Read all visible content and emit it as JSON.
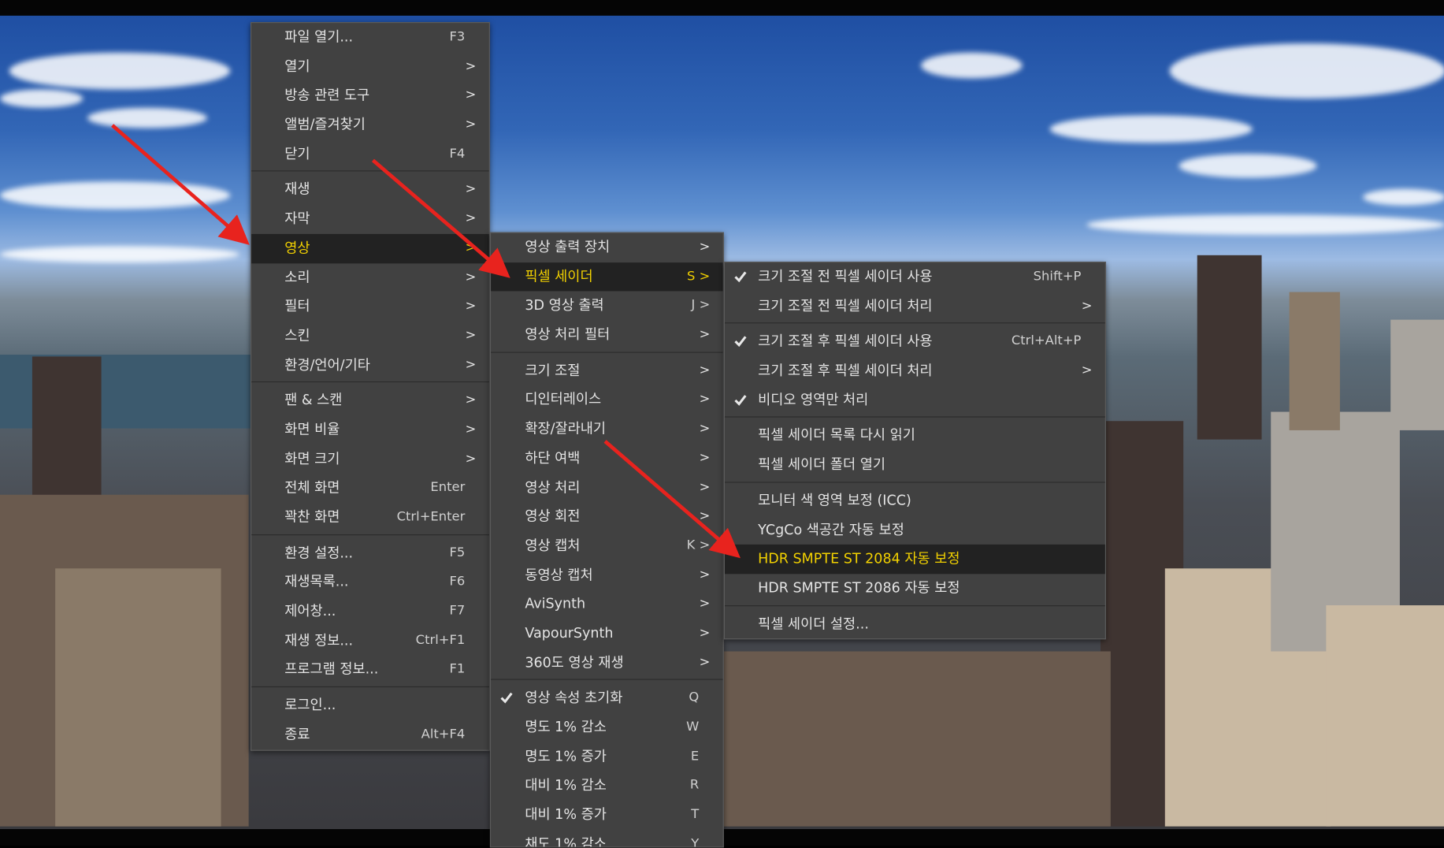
{
  "colors": {
    "menu_bg": "#414141",
    "highlight_bg": "#222222",
    "highlight_text": "#f2d100",
    "text": "#e4e4e4",
    "annotation_arrow": "#e8231e"
  },
  "main_menu": [
    {
      "label": "파일 열기...",
      "shortcut": "F3"
    },
    {
      "label": "열기",
      "shortcut": ">"
    },
    {
      "label": "방송 관련 도구",
      "shortcut": ">"
    },
    {
      "label": "앨범/즐겨찾기",
      "shortcut": ">"
    },
    {
      "label": "닫기",
      "shortcut": "F4"
    },
    {
      "separator": true
    },
    {
      "label": "재생",
      "shortcut": ">"
    },
    {
      "label": "자막",
      "shortcut": ">"
    },
    {
      "label": "영상",
      "shortcut": ">",
      "active": true
    },
    {
      "label": "소리",
      "shortcut": ">"
    },
    {
      "label": "필터",
      "shortcut": ">"
    },
    {
      "label": "스킨",
      "shortcut": ">"
    },
    {
      "label": "환경/언어/기타",
      "shortcut": ">"
    },
    {
      "separator": true
    },
    {
      "label": "팬 & 스캔",
      "shortcut": ">"
    },
    {
      "label": "화면 비율",
      "shortcut": ">"
    },
    {
      "label": "화면 크기",
      "shortcut": ">"
    },
    {
      "label": "전체 화면",
      "shortcut": "Enter"
    },
    {
      "label": "꽉찬 화면",
      "shortcut": "Ctrl+Enter"
    },
    {
      "separator": true
    },
    {
      "label": "환경 설정...",
      "shortcut": "F5"
    },
    {
      "label": "재생목록...",
      "shortcut": "F6"
    },
    {
      "label": "제어창...",
      "shortcut": "F7"
    },
    {
      "label": "재생 정보...",
      "shortcut": "Ctrl+F1"
    },
    {
      "label": "프로그램 정보...",
      "shortcut": "F1"
    },
    {
      "separator": true
    },
    {
      "label": "로그인...",
      "shortcut": ""
    },
    {
      "label": "종료",
      "shortcut": "Alt+F4"
    }
  ],
  "video_menu": [
    {
      "label": "영상 출력 장치",
      "shortcut": ">"
    },
    {
      "label": "픽셀 세이더",
      "shortcut": "S >",
      "active": true
    },
    {
      "label": "3D 영상 출력",
      "shortcut": "J >"
    },
    {
      "label": "영상 처리 필터",
      "shortcut": ">"
    },
    {
      "separator": true
    },
    {
      "label": "크기 조절",
      "shortcut": ">"
    },
    {
      "label": "디인터레이스",
      "shortcut": ">"
    },
    {
      "label": "확장/잘라내기",
      "shortcut": ">"
    },
    {
      "label": "하단 여백",
      "shortcut": ">"
    },
    {
      "label": "영상 처리",
      "shortcut": ">"
    },
    {
      "label": "영상 회전",
      "shortcut": ">"
    },
    {
      "label": "영상 캡처",
      "shortcut": "K >"
    },
    {
      "label": "동영상 캡처",
      "shortcut": ">"
    },
    {
      "label": "AviSynth",
      "shortcut": ">"
    },
    {
      "label": "VapourSynth",
      "shortcut": ">"
    },
    {
      "label": "360도 영상 재생",
      "shortcut": ">"
    },
    {
      "separator": true
    },
    {
      "label": "영상 속성 초기화",
      "shortcut": "Q",
      "checked": true
    },
    {
      "label": "명도 1% 감소",
      "shortcut": "W"
    },
    {
      "label": "명도 1% 증가",
      "shortcut": "E"
    },
    {
      "label": "대비 1% 감소",
      "shortcut": "R"
    },
    {
      "label": "대비 1% 증가",
      "shortcut": "T"
    },
    {
      "label": "채도 1% 감소",
      "shortcut": "Y"
    }
  ],
  "shader_menu": [
    {
      "label": "크기 조절 전 픽셀 세이더 사용",
      "shortcut": "Shift+P",
      "checked": true
    },
    {
      "label": "크기 조절 전 픽셀 세이더 처리",
      "shortcut": ">"
    },
    {
      "separator": true
    },
    {
      "label": "크기 조절 후 픽셀 세이더 사용",
      "shortcut": "Ctrl+Alt+P",
      "checked": true
    },
    {
      "label": "크기 조절 후 픽셀 세이더 처리",
      "shortcut": ">"
    },
    {
      "label": "비디오 영역만 처리",
      "shortcut": "",
      "checked": true
    },
    {
      "separator": true
    },
    {
      "label": "픽셀 세이더 목록 다시 읽기",
      "shortcut": ""
    },
    {
      "label": "픽셀 세이더 폴더 열기",
      "shortcut": ""
    },
    {
      "separator": true
    },
    {
      "label": "모니터 색 영역 보정 (ICC)",
      "shortcut": ""
    },
    {
      "label": "YCgCo 색공간 자동 보정",
      "shortcut": ""
    },
    {
      "label": "HDR SMPTE ST 2084 자동 보정",
      "shortcut": "",
      "active": true
    },
    {
      "label": "HDR SMPTE ST 2086 자동 보정",
      "shortcut": ""
    },
    {
      "separator": true
    },
    {
      "label": "픽셀 세이더 설정...",
      "shortcut": ""
    }
  ]
}
